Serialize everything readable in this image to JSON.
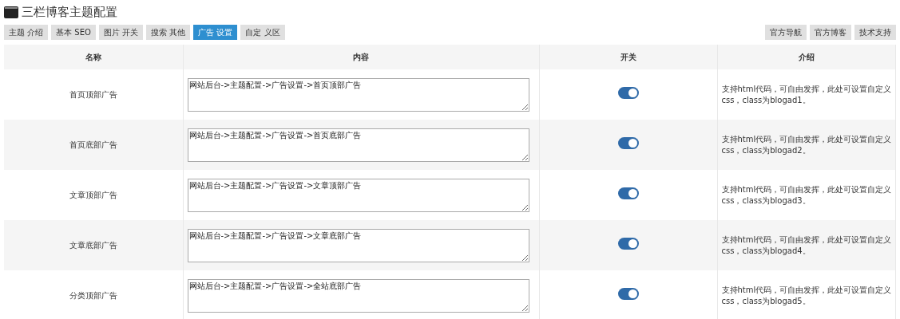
{
  "title": "三栏博客主题配置",
  "tabs": [
    {
      "label": "主题 介绍",
      "selected": false
    },
    {
      "label": "基本 SEO",
      "selected": false
    },
    {
      "label": "图片 开关",
      "selected": false
    },
    {
      "label": "搜索 其他",
      "selected": false
    },
    {
      "label": "广告 设置",
      "selected": true
    },
    {
      "label": "自定 义区",
      "selected": false
    }
  ],
  "links": [
    "官方导航",
    "官方博客",
    "技术支持"
  ],
  "table": {
    "columns": [
      "名称",
      "内容",
      "开关",
      "介绍"
    ],
    "rows": [
      {
        "name": "首页顶部广告",
        "content": "网站后台->主题配置->广告设置->首页顶部广告",
        "on": true,
        "note": "支持html代码，可自由发挥，此处可设置自定义css，class为blogad1。"
      },
      {
        "name": "首页底部广告",
        "content": "网站后台->主题配置->广告设置->首页底部广告",
        "on": true,
        "note": "支持html代码，可自由发挥，此处可设置自定义css，class为blogad2。"
      },
      {
        "name": "文章顶部广告",
        "content": "网站后台->主题配置->广告设置->文章顶部广告",
        "on": true,
        "note": "支持html代码，可自由发挥，此处可设置自定义css，class为blogad3。"
      },
      {
        "name": "文章底部广告",
        "content": "网站后台->主题配置->广告设置->文章底部广告",
        "on": true,
        "note": "支持html代码，可自由发挥，此处可设置自定义css，class为blogad4。"
      },
      {
        "name": "分类顶部广告",
        "content": "网站后台->主题配置->广告设置->全站底部广告",
        "on": true,
        "note": "支持html代码，可自由发挥，此处可设置自定义css，class为blogad5。"
      }
    ]
  }
}
